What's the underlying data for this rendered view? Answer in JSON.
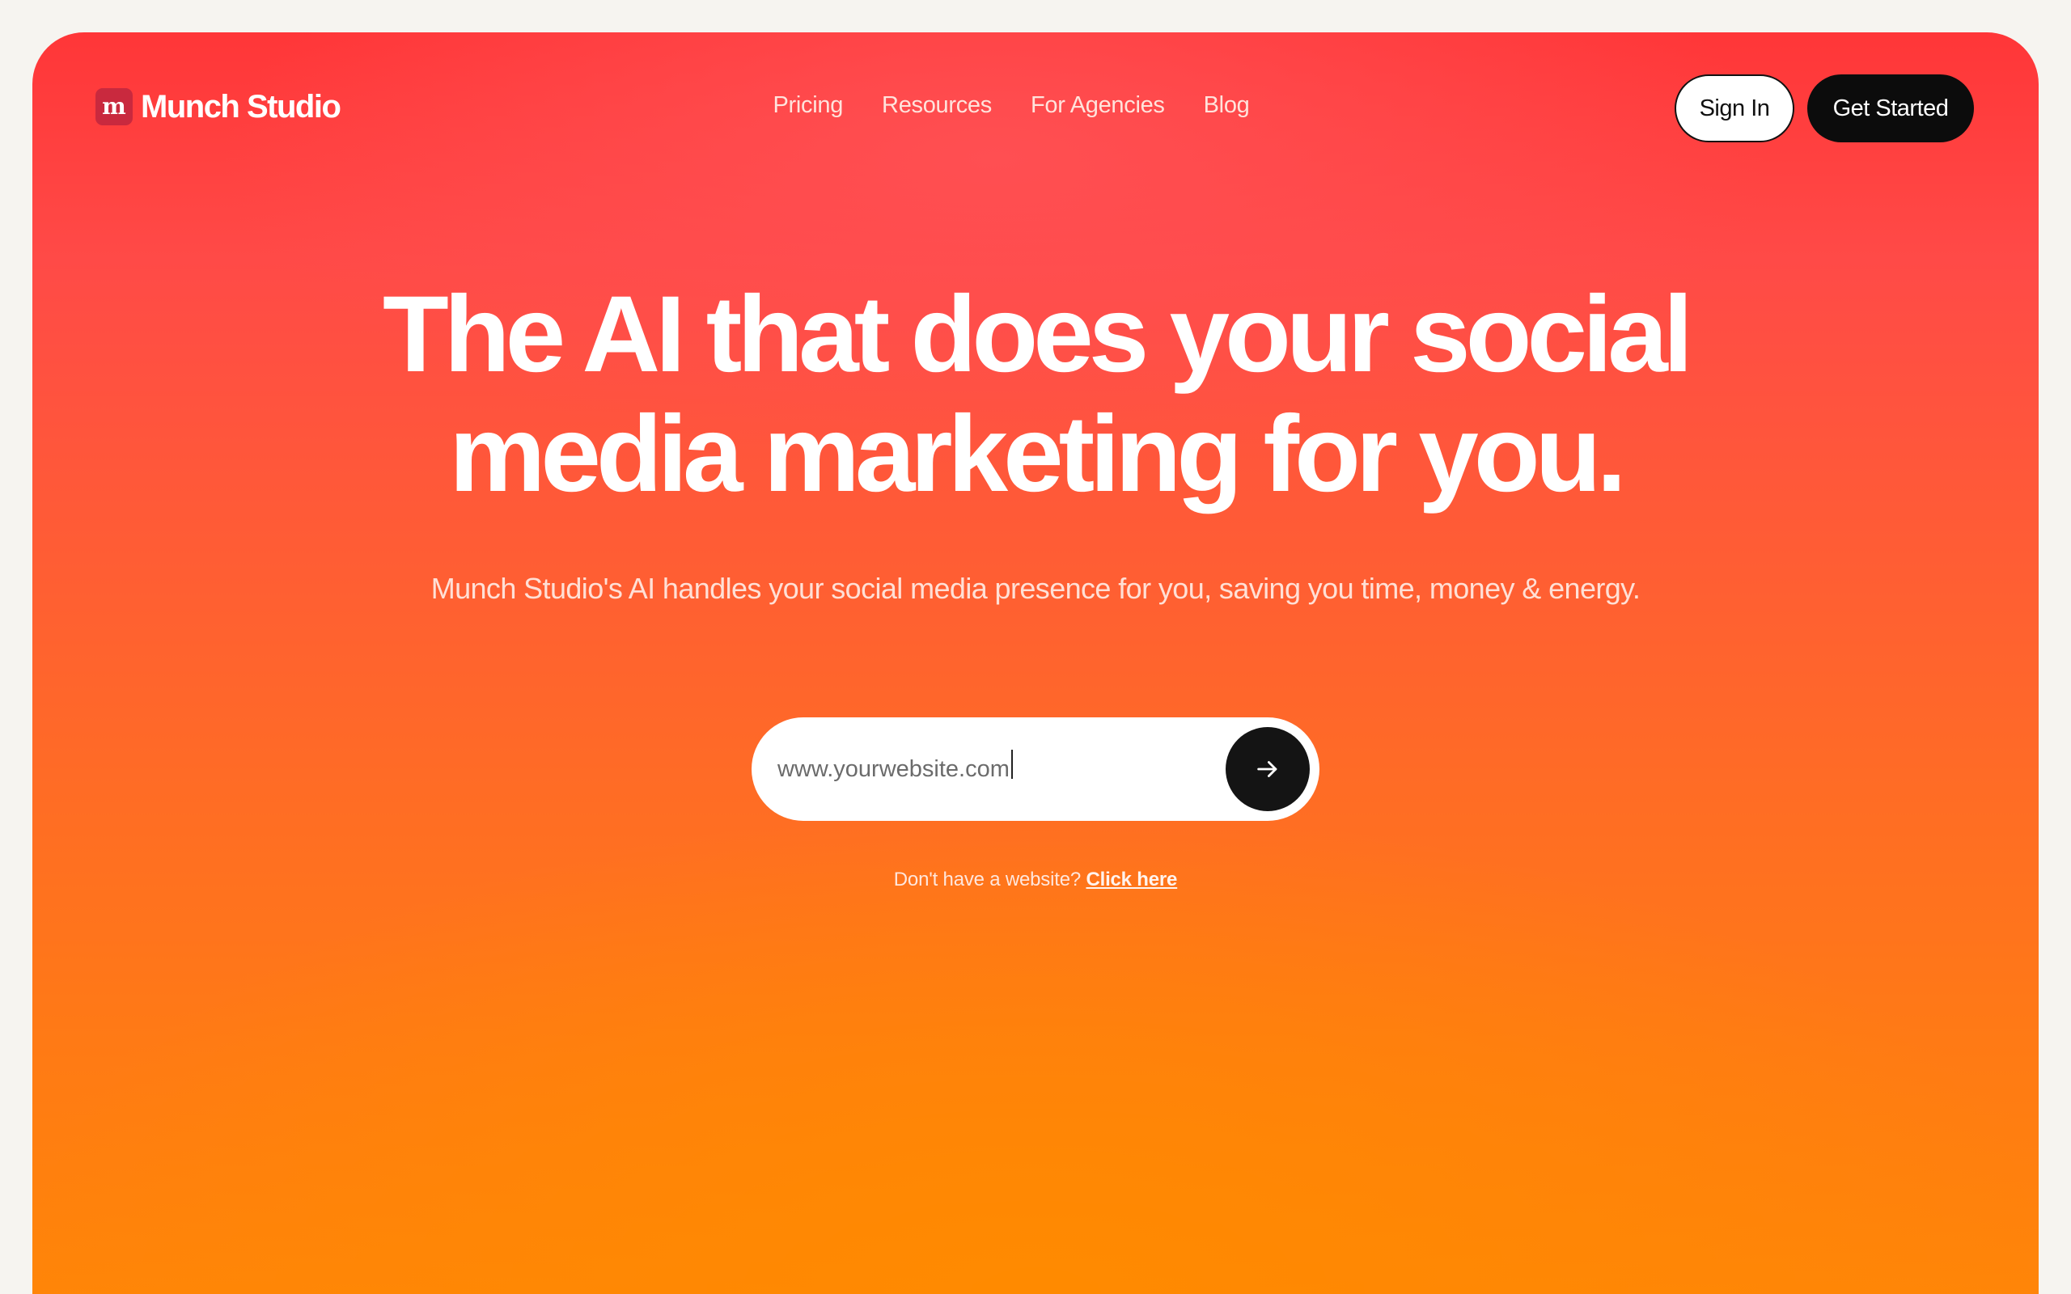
{
  "brand": {
    "mark": "m",
    "name": "Munch Studio"
  },
  "nav": {
    "items": [
      "Pricing",
      "Resources",
      "For Agencies",
      "Blog"
    ]
  },
  "header": {
    "sign_in": "Sign In",
    "get_started": "Get Started"
  },
  "hero": {
    "headline_line1": "The AI that does your social",
    "headline_line2": "media marketing for you.",
    "subhead": "Munch Studio's AI handles your social media presence for you, saving you time, money & energy."
  },
  "search": {
    "value": "www.yourwebsite.com",
    "submit_icon": "arrow-right-icon"
  },
  "helper": {
    "text": "Don't have a website? ",
    "link": "Click here"
  },
  "colors": {
    "gradient_top": "#ff3638",
    "gradient_bottom": "#ff8508",
    "button_dark": "#0c0c0c"
  }
}
